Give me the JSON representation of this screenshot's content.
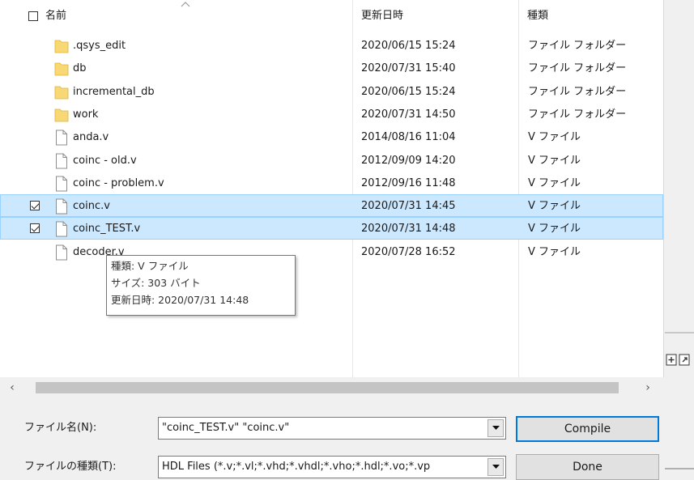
{
  "columns": {
    "name": "名前",
    "modified": "更新日時",
    "type": "種類"
  },
  "files": [
    {
      "name": ".qsys_edit",
      "modified": "2020/06/15 15:24",
      "type": "ファイル フォルダー",
      "kind": "folder",
      "checked": false,
      "selected": false
    },
    {
      "name": "db",
      "modified": "2020/07/31 15:40",
      "type": "ファイル フォルダー",
      "kind": "folder",
      "checked": false,
      "selected": false
    },
    {
      "name": "incremental_db",
      "modified": "2020/06/15 15:24",
      "type": "ファイル フォルダー",
      "kind": "folder",
      "checked": false,
      "selected": false
    },
    {
      "name": "work",
      "modified": "2020/07/31 14:50",
      "type": "ファイル フォルダー",
      "kind": "folder",
      "checked": false,
      "selected": false
    },
    {
      "name": "anda.v",
      "modified": "2014/08/16 11:04",
      "type": "V ファイル",
      "kind": "file",
      "checked": false,
      "selected": false
    },
    {
      "name": "coinc - old.v",
      "modified": "2012/09/09 14:20",
      "type": "V ファイル",
      "kind": "file",
      "checked": false,
      "selected": false
    },
    {
      "name": "coinc - problem.v",
      "modified": "2012/09/16 11:48",
      "type": "V ファイル",
      "kind": "file",
      "checked": false,
      "selected": false
    },
    {
      "name": "coinc.v",
      "modified": "2020/07/31 14:45",
      "type": "V ファイル",
      "kind": "file",
      "checked": true,
      "selected": true
    },
    {
      "name": "coinc_TEST.v",
      "modified": "2020/07/31 14:48",
      "type": "V ファイル",
      "kind": "file",
      "checked": true,
      "selected": true
    },
    {
      "name": "decoder.v",
      "modified": "2020/07/28 16:52",
      "type": "V ファイル",
      "kind": "file",
      "checked": false,
      "selected": false
    }
  ],
  "tooltip": {
    "line1": "種類: V ファイル",
    "line2": "サイズ: 303 バイト",
    "line3": "更新日時: 2020/07/31 14:48"
  },
  "filename": {
    "label": "ファイル名(N):",
    "value": "\"coinc_TEST.v\" \"coinc.v\""
  },
  "filetype": {
    "label": "ファイルの種類(T):",
    "value": "HDL Files (*.v;*.vl;*.vhd;*.vhdl;*.vho;*.hdl;*.vo;*.vp"
  },
  "buttons": {
    "compile": "Compile",
    "done": "Done"
  },
  "colors": {
    "selection_bg": "#cce8ff",
    "selection_border": "#99d1ff",
    "folder": "#f8d775",
    "accent": "#0078d7"
  }
}
